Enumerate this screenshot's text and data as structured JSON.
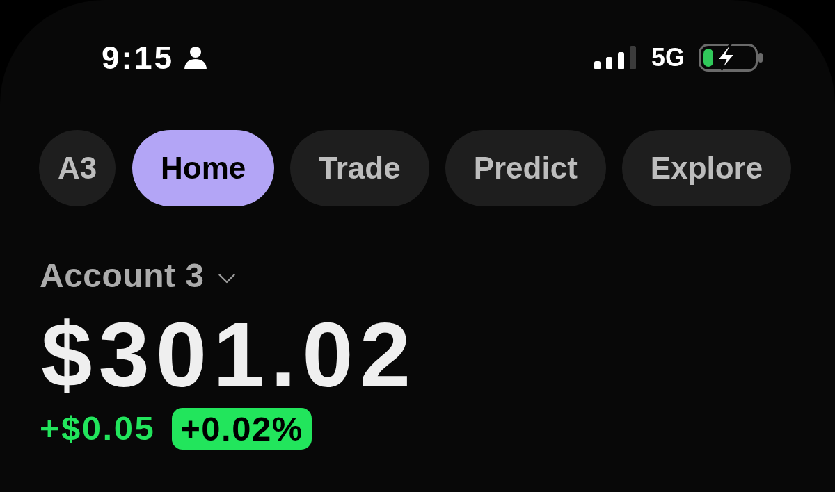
{
  "status_bar": {
    "time": "9:15",
    "network": "5G"
  },
  "account_button": {
    "label": "A3"
  },
  "tabs": [
    {
      "label": "Home",
      "selected": true
    },
    {
      "label": "Trade",
      "selected": false
    },
    {
      "label": "Predict",
      "selected": false
    },
    {
      "label": "Explore",
      "selected": false
    }
  ],
  "account": {
    "name": "Account 3",
    "balance": "$301.02",
    "change": "+$0.05",
    "change_percent": "+0.02%",
    "gain": true
  }
}
